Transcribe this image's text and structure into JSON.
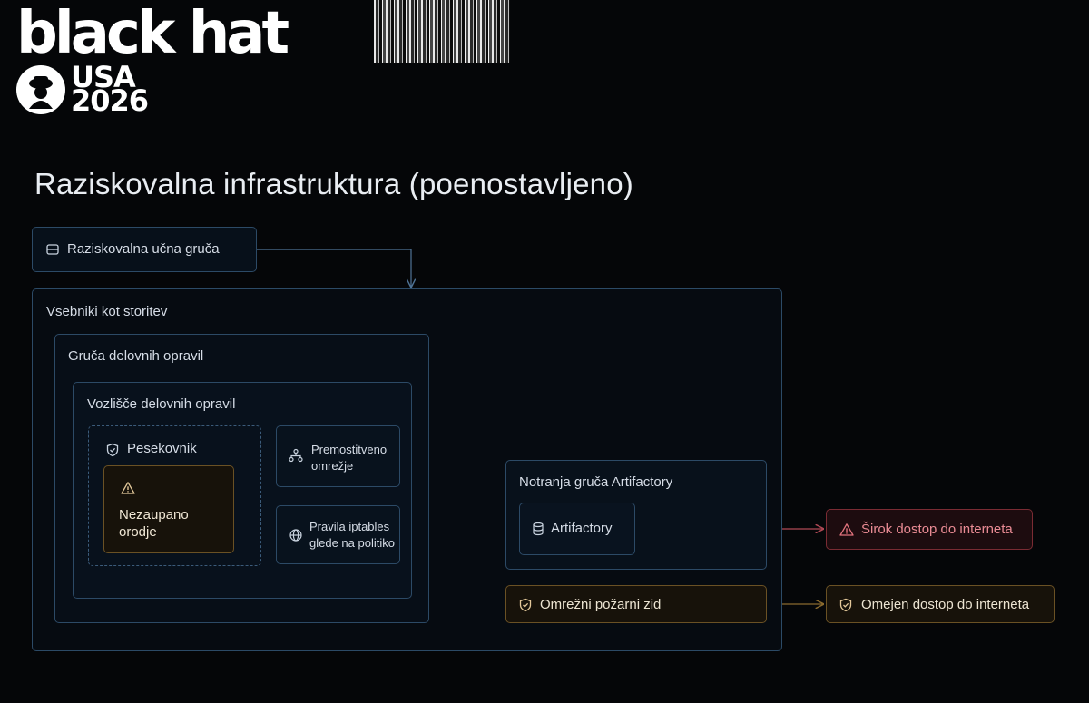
{
  "logo": {
    "word": "black hat",
    "region": "USA",
    "year": "2026"
  },
  "slide_title": "Raziskovalna infrastruktura (poenostavljeno)",
  "nodes": {
    "cluster": "Raziskovalna učna gruča",
    "caas": "Vsebniki kot storitev",
    "job_cluster": "Gruča delovnih opravil",
    "job_node": "Vozlišče delovnih opravil",
    "sandbox": "Pesekovnik",
    "untrusted_line1": "Nezaupano",
    "untrusted_line2": "orodje",
    "bridge_line1": "Premostitveno",
    "bridge_line2": "omrežje",
    "iptables_line1": "Pravila iptables",
    "iptables_line2": "glede na politiko",
    "artifactory_cluster": "Notranja gruča Artifactory",
    "artifactory": "Artifactory",
    "firewall": "Omrežni požarni zid",
    "broad_access": "Širok dostop do interneta",
    "limited_access": "Omejen dostop do interneta"
  },
  "colors": {
    "box_border": "#2c4a66",
    "arrow": "#4f7396",
    "warning_red": "#e2737d",
    "amber": "#6a5124",
    "text": "#d6dde7"
  },
  "icons": {
    "cluster": "server-icon",
    "sandbox": "shield-icon",
    "untrusted": "warning-icon",
    "bridge": "network-icon",
    "iptables": "globe-icon",
    "artifactory": "database-icon",
    "firewall": "shield-icon",
    "broad_access": "warning-icon",
    "limited_access": "shield-icon"
  }
}
